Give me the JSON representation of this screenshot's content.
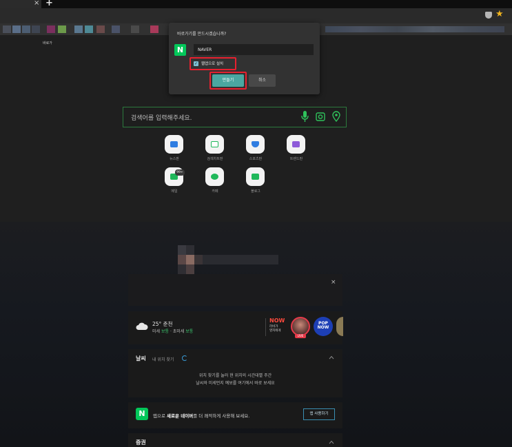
{
  "browser": {
    "tab_close": "×",
    "new_tab": "+",
    "star": "★"
  },
  "page": {
    "tiny_label": "바로가"
  },
  "dialog": {
    "title": "바로가기를 만드시겠습니까?",
    "logo": "N",
    "name_value": "NAVER",
    "checkbox_label": "웹앱으로 설치",
    "checkbox_mark": "✓",
    "checked": true,
    "create_label": "만들기",
    "cancel_label": "취소"
  },
  "search": {
    "placeholder": "검색어를 입력해주세요."
  },
  "shortcuts": [
    {
      "label": "뉴스판",
      "color": "#2f7de1"
    },
    {
      "label": "검색차트판",
      "color": "#1fb85a"
    },
    {
      "label": "스포츠판",
      "color": "#2f7de1"
    },
    {
      "label": "트렌드판",
      "color": "#8e5bd9"
    },
    {
      "label": "메일",
      "color": "#1fb85a",
      "badge": "99+"
    },
    {
      "label": "카페",
      "color": "#1fb85a"
    },
    {
      "label": "블로그",
      "color": "#1fb85a"
    }
  ],
  "weather_strip": {
    "temp": "25° 춘천",
    "dust_prefix": "미세",
    "dust_value": "보통",
    "dust_mid": "· 초미세",
    "fine_value": "보통",
    "now_logo": "NOW",
    "now_sub1": "라비가",
    "now_sub2": "영지에게",
    "live": "LIVE",
    "pop": "POP NOW"
  },
  "weather_card": {
    "title": "날씨",
    "find_location": "내 위치 찾기",
    "line1": "위치 찾기를 눌러 현 위치의 시간대별 주간",
    "line2": "날씨와 미세먼지 예보를 여기에서 바로 보세요"
  },
  "app_card": {
    "logo": "N",
    "promo_pre": "앱으로",
    "promo_bold": "새로운 네이버",
    "promo_post": "를 더 쾌적하게 사용해 보세요.",
    "button": "앱 사용하기"
  },
  "stock_card": {
    "title": "증권"
  },
  "close_symbol": "×",
  "colors": {
    "accent_green": "#03c75a",
    "teal_button": "#4aa7a1",
    "highlight_red": "#e8202f"
  }
}
